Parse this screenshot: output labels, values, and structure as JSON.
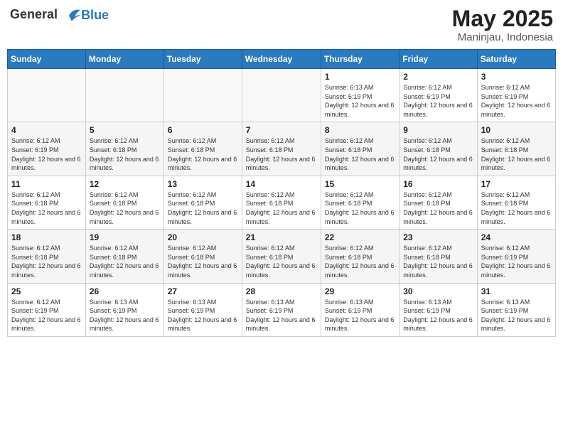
{
  "header": {
    "logo_general": "General",
    "logo_blue": "Blue",
    "month_year": "May 2025",
    "location": "Maninjau, Indonesia"
  },
  "days_of_week": [
    "Sunday",
    "Monday",
    "Tuesday",
    "Wednesday",
    "Thursday",
    "Friday",
    "Saturday"
  ],
  "weeks": [
    [
      {
        "day": "",
        "info": ""
      },
      {
        "day": "",
        "info": ""
      },
      {
        "day": "",
        "info": ""
      },
      {
        "day": "",
        "info": ""
      },
      {
        "day": "1",
        "info": "Sunrise: 6:13 AM\nSunset: 6:19 PM\nDaylight: 12 hours and 6 minutes."
      },
      {
        "day": "2",
        "info": "Sunrise: 6:12 AM\nSunset: 6:19 PM\nDaylight: 12 hours and 6 minutes."
      },
      {
        "day": "3",
        "info": "Sunrise: 6:12 AM\nSunset: 6:19 PM\nDaylight: 12 hours and 6 minutes."
      }
    ],
    [
      {
        "day": "4",
        "info": "Sunrise: 6:12 AM\nSunset: 6:19 PM\nDaylight: 12 hours and 6 minutes."
      },
      {
        "day": "5",
        "info": "Sunrise: 6:12 AM\nSunset: 6:18 PM\nDaylight: 12 hours and 6 minutes."
      },
      {
        "day": "6",
        "info": "Sunrise: 6:12 AM\nSunset: 6:18 PM\nDaylight: 12 hours and 6 minutes."
      },
      {
        "day": "7",
        "info": "Sunrise: 6:12 AM\nSunset: 6:18 PM\nDaylight: 12 hours and 6 minutes."
      },
      {
        "day": "8",
        "info": "Sunrise: 6:12 AM\nSunset: 6:18 PM\nDaylight: 12 hours and 6 minutes."
      },
      {
        "day": "9",
        "info": "Sunrise: 6:12 AM\nSunset: 6:18 PM\nDaylight: 12 hours and 6 minutes."
      },
      {
        "day": "10",
        "info": "Sunrise: 6:12 AM\nSunset: 6:18 PM\nDaylight: 12 hours and 6 minutes."
      }
    ],
    [
      {
        "day": "11",
        "info": "Sunrise: 6:12 AM\nSunset: 6:18 PM\nDaylight: 12 hours and 6 minutes."
      },
      {
        "day": "12",
        "info": "Sunrise: 6:12 AM\nSunset: 6:18 PM\nDaylight: 12 hours and 6 minutes."
      },
      {
        "day": "13",
        "info": "Sunrise: 6:12 AM\nSunset: 6:18 PM\nDaylight: 12 hours and 6 minutes."
      },
      {
        "day": "14",
        "info": "Sunrise: 6:12 AM\nSunset: 6:18 PM\nDaylight: 12 hours and 6 minutes."
      },
      {
        "day": "15",
        "info": "Sunrise: 6:12 AM\nSunset: 6:18 PM\nDaylight: 12 hours and 6 minutes."
      },
      {
        "day": "16",
        "info": "Sunrise: 6:12 AM\nSunset: 6:18 PM\nDaylight: 12 hours and 6 minutes."
      },
      {
        "day": "17",
        "info": "Sunrise: 6:12 AM\nSunset: 6:18 PM\nDaylight: 12 hours and 6 minutes."
      }
    ],
    [
      {
        "day": "18",
        "info": "Sunrise: 6:12 AM\nSunset: 6:18 PM\nDaylight: 12 hours and 6 minutes."
      },
      {
        "day": "19",
        "info": "Sunrise: 6:12 AM\nSunset: 6:18 PM\nDaylight: 12 hours and 6 minutes."
      },
      {
        "day": "20",
        "info": "Sunrise: 6:12 AM\nSunset: 6:18 PM\nDaylight: 12 hours and 6 minutes."
      },
      {
        "day": "21",
        "info": "Sunrise: 6:12 AM\nSunset: 6:18 PM\nDaylight: 12 hours and 6 minutes."
      },
      {
        "day": "22",
        "info": "Sunrise: 6:12 AM\nSunset: 6:18 PM\nDaylight: 12 hours and 6 minutes."
      },
      {
        "day": "23",
        "info": "Sunrise: 6:12 AM\nSunset: 6:18 PM\nDaylight: 12 hours and 6 minutes."
      },
      {
        "day": "24",
        "info": "Sunrise: 6:12 AM\nSunset: 6:19 PM\nDaylight: 12 hours and 6 minutes."
      }
    ],
    [
      {
        "day": "25",
        "info": "Sunrise: 6:12 AM\nSunset: 6:19 PM\nDaylight: 12 hours and 6 minutes."
      },
      {
        "day": "26",
        "info": "Sunrise: 6:13 AM\nSunset: 6:19 PM\nDaylight: 12 hours and 6 minutes."
      },
      {
        "day": "27",
        "info": "Sunrise: 6:13 AM\nSunset: 6:19 PM\nDaylight: 12 hours and 6 minutes."
      },
      {
        "day": "28",
        "info": "Sunrise: 6:13 AM\nSunset: 6:19 PM\nDaylight: 12 hours and 6 minutes."
      },
      {
        "day": "29",
        "info": "Sunrise: 6:13 AM\nSunset: 6:19 PM\nDaylight: 12 hours and 6 minutes."
      },
      {
        "day": "30",
        "info": "Sunrise: 6:13 AM\nSunset: 6:19 PM\nDaylight: 12 hours and 6 minutes."
      },
      {
        "day": "31",
        "info": "Sunrise: 6:13 AM\nSunset: 6:19 PM\nDaylight: 12 hours and 6 minutes."
      }
    ]
  ]
}
